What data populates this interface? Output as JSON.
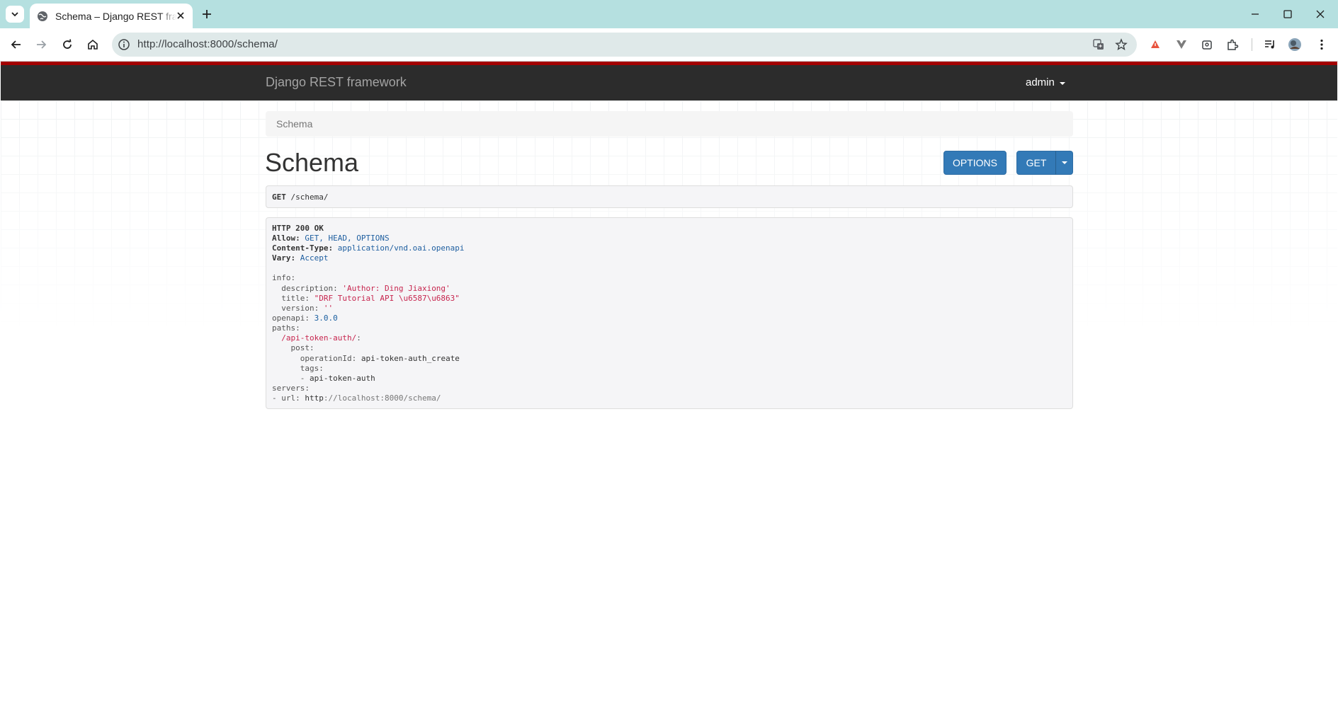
{
  "browser": {
    "tab_title": "Schema – Django REST framework",
    "url": "http://localhost:8000/schema/"
  },
  "navbar": {
    "brand": "Django REST framework",
    "user": "admin"
  },
  "breadcrumb": {
    "current": "Schema"
  },
  "page": {
    "title": "Schema",
    "options_label": "OPTIONS",
    "get_label": "GET"
  },
  "request": {
    "method": "GET",
    "path": "/schema/"
  },
  "response": {
    "status": "HTTP 200 OK",
    "headers": {
      "allow_key": "Allow:",
      "allow_value": "GET, HEAD, OPTIONS",
      "content_type_key": "Content-Type:",
      "content_type_value": "application/vnd.oai.openapi",
      "vary_key": "Vary:",
      "vary_value": "Accept"
    },
    "body": {
      "info_key": "info:",
      "description_key": "description:",
      "description_value": "'Author: Ding Jiaxiong'",
      "title_key": "title:",
      "title_value": "\"DRF Tutorial API \\u6587\\u6863\"",
      "version_key": "version:",
      "version_value": "''",
      "openapi_key": "openapi:",
      "openapi_value": "3.0.0",
      "paths_key": "paths:",
      "path_name": "/api-token-auth/",
      "path_colon": ":",
      "post_key": "post:",
      "operation_id_key": "operationId:",
      "operation_id_value": "api-token-auth_create",
      "tags_key": "tags:",
      "tag_item_dash": "- ",
      "tag_item": "api-token-auth",
      "servers_key": "servers:",
      "server_dash": "- ",
      "server_url_key": "url:",
      "server_url_scheme": "http",
      "server_url_rest": "://localhost:8000/schema/"
    }
  }
}
